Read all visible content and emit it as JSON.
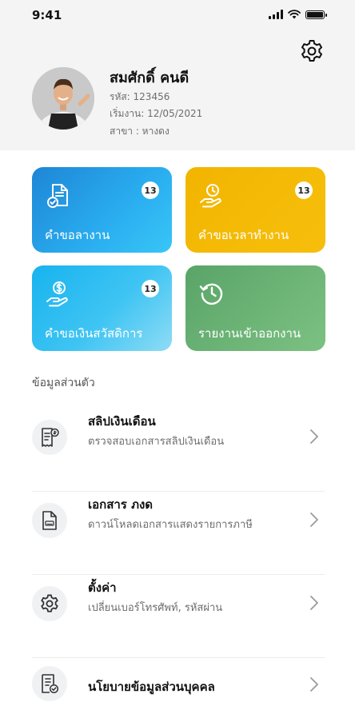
{
  "status_bar": {
    "time": "9:41"
  },
  "profile": {
    "name": "สมศักดิ์ คนดี",
    "code": "รหัส: 123456",
    "start_date": "เริ่มงาน: 12/05/2021",
    "branch": "สาขา : หางดง"
  },
  "cards": [
    {
      "label": "คำขอลางาน",
      "badge": "13",
      "icon": "leave-document-icon",
      "color": "#1e86d6"
    },
    {
      "label": "คำขอเวลาทำงาน",
      "badge": "13",
      "icon": "time-request-icon",
      "color": "#f2b500"
    },
    {
      "label": "คำขอเงินสวัสดิการ",
      "badge": "13",
      "icon": "money-hand-icon",
      "color": "#18b3ef"
    },
    {
      "label": "รายงานเข้าออกงาน",
      "icon": "history-clock-icon",
      "color": "#5aa468"
    }
  ],
  "section": {
    "title": "ข้อมูลส่วนตัว"
  },
  "menu": [
    {
      "title": "สลิปเงินเดือน",
      "subtitle": "ตรวจสอบเอกสารสลิปเงินเดือน",
      "icon": "payslip-icon"
    },
    {
      "title": "เอกสาร ภงด",
      "subtitle": "ดาวน์โหลดเอกสารแสดงรายการภาษี",
      "icon": "tax-document-icon"
    },
    {
      "title": "ตั้งค่า",
      "subtitle": "เปลี่ยนเบอร์โทรศัพท์, รหัสผ่าน",
      "icon": "gear-icon"
    },
    {
      "title": "นโยบายข้อมูลส่วนบุคคล",
      "subtitle": "",
      "icon": "policy-document-icon"
    }
  ]
}
